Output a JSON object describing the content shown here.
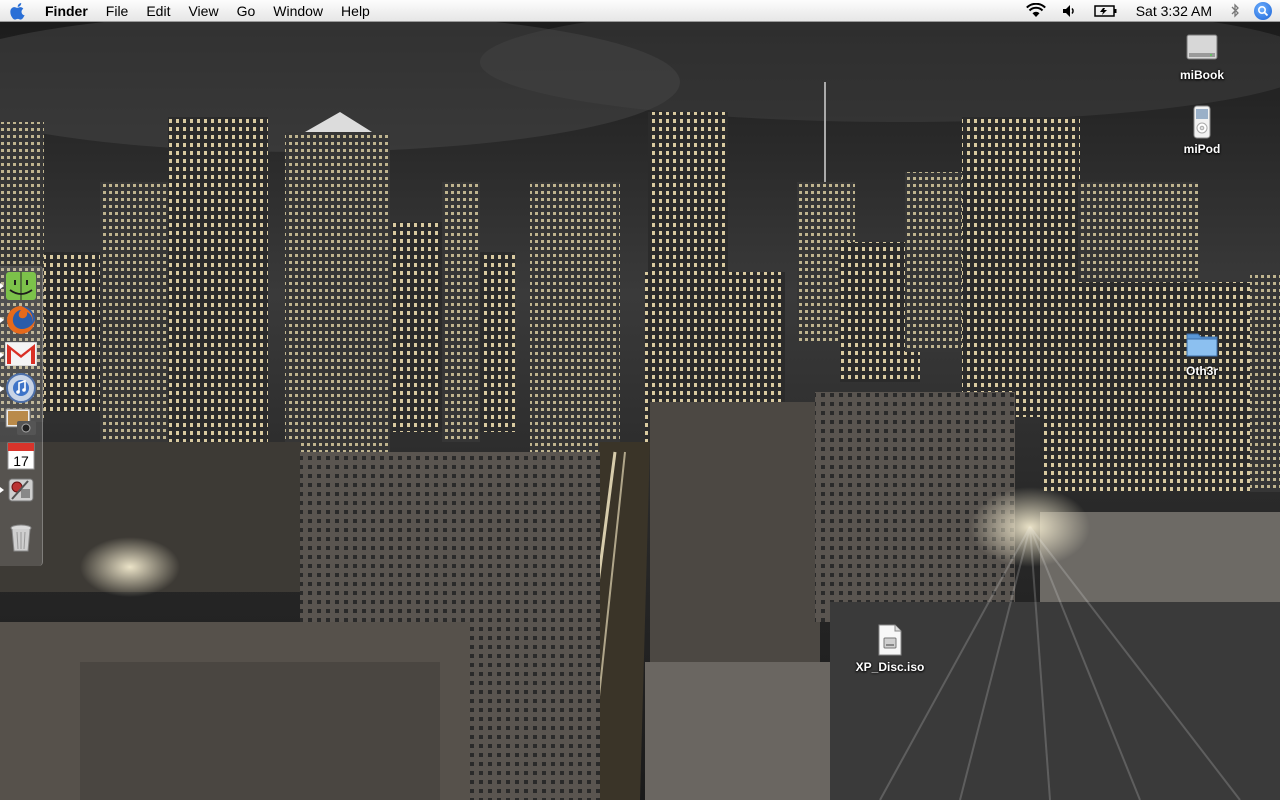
{
  "menubar": {
    "apple_icon": "apple-logo-icon",
    "app_name": "Finder",
    "menus": [
      "File",
      "Edit",
      "View",
      "Go",
      "Window",
      "Help"
    ],
    "status": {
      "wifi_icon": "wifi-icon",
      "volume_icon": "speaker-icon",
      "battery_icon": "battery-icon",
      "clock": "Sat 3:32 AM",
      "bluetooth_icon": "bluetooth-icon",
      "spotlight_icon": "spotlight-search-icon"
    }
  },
  "dock": {
    "items": [
      {
        "name": "Finder",
        "icon": "finder-icon",
        "running": true
      },
      {
        "name": "Firefox",
        "icon": "firefox-icon",
        "running": true
      },
      {
        "name": "Gmail",
        "icon": "gmail-icon",
        "running": true
      },
      {
        "name": "iTunes",
        "icon": "itunes-icon",
        "running": true
      },
      {
        "name": "iPhoto",
        "icon": "iphoto-icon",
        "running": false
      },
      {
        "name": "iCal",
        "icon": "ical-icon",
        "running": false,
        "badge": "17"
      },
      {
        "name": "System Preferences",
        "icon": "system-preferences-icon",
        "running": true
      },
      {
        "name": "Trash",
        "icon": "trash-icon",
        "running": false
      }
    ]
  },
  "desktop": {
    "icons": [
      {
        "label": "miBook",
        "icon": "hard-drive-icon"
      },
      {
        "label": "miPod",
        "icon": "ipod-icon"
      },
      {
        "label": "Oth3r",
        "icon": "folder-icon"
      },
      {
        "label": "XP_Disc.iso",
        "icon": "disk-image-file-icon"
      }
    ]
  },
  "colors": {
    "menubar_bg": "#ececec",
    "folder_blue": "#6aa9e6",
    "spotlight_blue": "#1a63d6"
  }
}
